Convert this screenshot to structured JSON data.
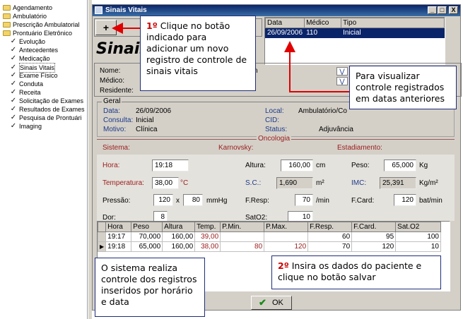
{
  "tree": {
    "items": [
      {
        "label": "Agendamento",
        "icon": "folder-icon"
      },
      {
        "label": "Ambulatório",
        "icon": "folder-icon"
      },
      {
        "label": "Prescrição Ambulatorial",
        "icon": "folder-icon"
      },
      {
        "label": "Prontuário Eletrônico",
        "icon": "folder-open-icon"
      },
      {
        "label": "Evolução",
        "icon": "check-icon"
      },
      {
        "label": "Antecedentes",
        "icon": "check-icon"
      },
      {
        "label": "Medicação",
        "icon": "check-icon"
      },
      {
        "label": "Sinais Vitais",
        "icon": "check-icon"
      },
      {
        "label": "Exame Físico",
        "icon": "check-icon"
      },
      {
        "label": "Conduta",
        "icon": "check-icon"
      },
      {
        "label": "Receita",
        "icon": "check-icon"
      },
      {
        "label": "Solicitação de Exames",
        "icon": "check-icon"
      },
      {
        "label": "Resultados de Exames",
        "icon": "check-icon"
      },
      {
        "label": "Pesquisa de Prontuári",
        "icon": "check-icon"
      },
      {
        "label": "Imaging",
        "icon": "check-icon"
      }
    ]
  },
  "window": {
    "title": "Sinais Vitais",
    "heading": "Sinais",
    "add_symbol": "+",
    "minimize": "_",
    "maximize": "□",
    "close": "X"
  },
  "history": {
    "columns": [
      "Data",
      "Médico",
      "Tipo"
    ],
    "rows": [
      [
        "26/09/2006",
        "110",
        "Inicial"
      ]
    ]
  },
  "patient": {
    "name_label": "Nome:",
    "name_value": "C",
    "doctor_label": "Médico:",
    "doctor_value": "F",
    "resident_label": "Residente:",
    "partial_value": "n"
  },
  "geral": {
    "group_label": "Geral",
    "data_label": "Data:",
    "data_value": "26/09/2006",
    "consulta_label": "Consulta:",
    "consulta_value": "Inicial",
    "motivo_label": "Motivo:",
    "motivo_value": "Clínica",
    "local_label": "Local:",
    "local_value": "Ambulatório/Co",
    "cid_label": "CID:",
    "cid_value": "",
    "status_label": "Status:",
    "status_value": "Adjuvância"
  },
  "oncologia": {
    "group_label": "Oncologia",
    "sistema_label": "Sistema:",
    "karnovsky_label": "Karnovsky:",
    "estadiamento_label": "Estadiamento:"
  },
  "vitals": {
    "hora_label": "Hora:",
    "hora_value": "19:18",
    "altura_label": "Altura:",
    "altura_value": "160,00",
    "altura_unit": "cm",
    "peso_label": "Peso:",
    "peso_value": "65,000",
    "peso_unit": "Kg",
    "temp_label": "Temperatura:",
    "temp_value": "38,00",
    "temp_unit": "°C",
    "sc_label": "S.C.:",
    "sc_value": "1,690",
    "sc_unit": "m²",
    "imc_label": "IMC:",
    "imc_value": "25,391",
    "imc_unit": "Kg/m²",
    "pressao_label": "Pressão:",
    "pressao_sys": "120",
    "pressao_x": "x",
    "pressao_dia": "80",
    "pressao_unit": "mmHg",
    "fresp_label": "F.Resp:",
    "fresp_value": "70",
    "fresp_unit": "/min",
    "fcard_label": "F.Card:",
    "fcard_value": "120",
    "fcard_unit": "bat/min",
    "dor_label": "Dor:",
    "dor_value": "8",
    "sat_label": "SatO2:",
    "sat_value": "10"
  },
  "records": {
    "columns": [
      "Hora",
      "Peso",
      "Altura",
      "Temp.",
      "P.Min.",
      "P.Max.",
      "F.Resp.",
      "F.Card.",
      "Sat.O2"
    ],
    "rows": [
      [
        "19:17",
        "70,000",
        "160,00",
        "39,00",
        "",
        "",
        "60",
        "95",
        "100"
      ],
      [
        "19:18",
        "65,000",
        "160,00",
        "38,00",
        "80",
        "120",
        "70",
        "120",
        "10"
      ]
    ]
  },
  "ok_label": "OK",
  "callouts": {
    "c1_num": "1º",
    "c1_text": " Clique no botão indicado para adicionar um novo registro de controle de sinais vitais",
    "c2_text": "Para visualizar controle registrados em datas anteriores",
    "c3_text": "O sistema realiza controle dos registros inseridos por horário e data",
    "c4_num": "2º",
    "c4_text": " Insira os dados do paciente e clique no botão salvar"
  },
  "colors": {
    "accent": "#c00000",
    "title_bar": "#0a246a",
    "callout_border": "#1f2d7a"
  }
}
